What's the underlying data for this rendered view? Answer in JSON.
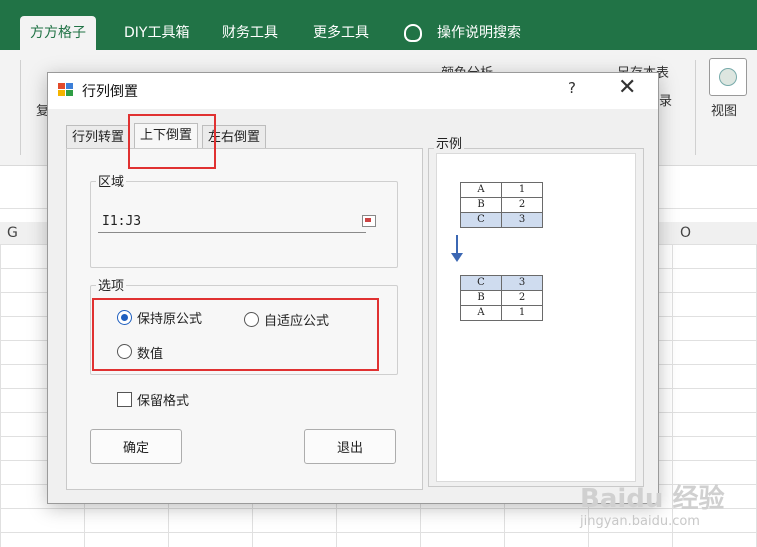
{
  "ribbon": {
    "tabs": [
      "方方格子",
      "DIY工具箱",
      "财务工具",
      "更多工具"
    ],
    "search_label": "操作说明搜索",
    "color_analysis": "颜色分析",
    "save_as_label": "另存本表",
    "view_label": "视图",
    "frag_fu": "复",
    "frag_lu": "录",
    "title_fragment": "..."
  },
  "columns": [
    "G",
    "O"
  ],
  "dialog": {
    "title": "行列倒置",
    "help": "?",
    "close": "✕",
    "tabs": [
      "行列转置",
      "上下倒置",
      "左右倒置"
    ],
    "selected_tab": "上下倒置",
    "area_group": "区域",
    "range_value": "I1:J3",
    "options_group": "选项",
    "opt_keep_formula": "保持原公式",
    "opt_adaptive_formula": "自适应公式",
    "opt_values": "数值",
    "opt_keep_format": "保留格式",
    "ok": "确定",
    "exit": "退出",
    "example_label": "示例",
    "example_before": [
      [
        "A",
        "1"
      ],
      [
        "B",
        "2"
      ],
      [
        "C",
        "3"
      ]
    ],
    "example_after": [
      [
        "C",
        "3"
      ],
      [
        "B",
        "2"
      ],
      [
        "A",
        "1"
      ]
    ]
  },
  "watermark": {
    "brand": "Baidu 经验",
    "url": "jingyan.baidu.com"
  },
  "colors": {
    "excel_green": "#217346",
    "highlight": "#e03131",
    "radio_blue": "#1f5fbf",
    "arrow_blue": "#3b67b3"
  }
}
